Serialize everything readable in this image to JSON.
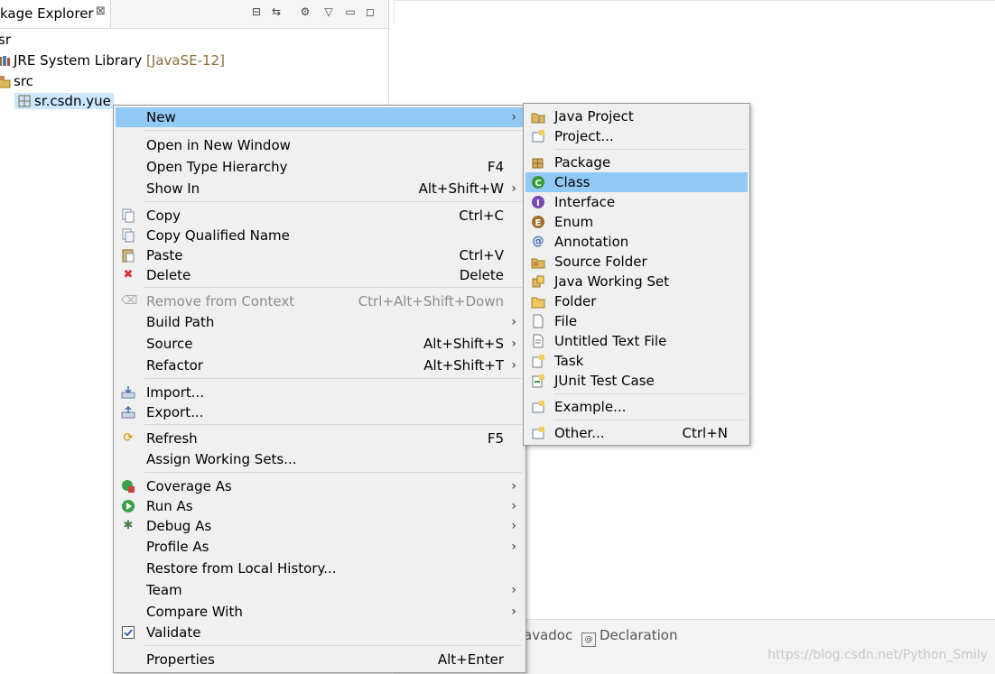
{
  "colors": {
    "highlight": "#91c9f7",
    "selection": "#cce8ff",
    "menu_bg": "#f0f0f0"
  },
  "package_explorer": {
    "tab_label": "kage Explorer",
    "close_glyph": "⊠",
    "tree": {
      "project": "sr",
      "jre_label": "JRE System Library",
      "jre_version": "[JavaSE-12]",
      "src": "src",
      "package": "sr.csdn.yue"
    }
  },
  "bottom": {
    "javadoc_tab": "avadoc",
    "declaration_tab": "Declaration",
    "watermark": "https://blog.csdn.net/Python_Smily"
  },
  "main_menu": [
    {
      "label": "New",
      "accel": "",
      "submenu": true,
      "icon": ""
    },
    {
      "label": "Open in New Window",
      "accel": "",
      "icon": ""
    },
    {
      "label": "Open Type Hierarchy",
      "accel": "F4",
      "icon": ""
    },
    {
      "label": "Show In",
      "accel": "Alt+Shift+W",
      "submenu": true,
      "icon": ""
    },
    {
      "label": "Copy",
      "accel": "Ctrl+C",
      "icon": "copy-icon"
    },
    {
      "label": "Copy Qualified Name",
      "accel": "",
      "icon": "copy-qualified-icon"
    },
    {
      "label": "Paste",
      "accel": "Ctrl+V",
      "icon": "paste-icon"
    },
    {
      "label": "Delete",
      "accel": "Delete",
      "icon": "delete-icon"
    },
    {
      "label": "Remove from Context",
      "accel": "Ctrl+Alt+Shift+Down",
      "disabled": true,
      "icon": "remove-context-icon"
    },
    {
      "label": "Build Path",
      "accel": "",
      "submenu": true,
      "icon": ""
    },
    {
      "label": "Source",
      "accel": "Alt+Shift+S",
      "submenu": true,
      "icon": ""
    },
    {
      "label": "Refactor",
      "accel": "Alt+Shift+T",
      "submenu": true,
      "icon": ""
    },
    {
      "label": "Import...",
      "accel": "",
      "icon": "import-icon"
    },
    {
      "label": "Export...",
      "accel": "",
      "icon": "export-icon"
    },
    {
      "label": "Refresh",
      "accel": "F5",
      "icon": "refresh-icon"
    },
    {
      "label": "Assign Working Sets...",
      "accel": "",
      "icon": ""
    },
    {
      "label": "Coverage As",
      "accel": "",
      "submenu": true,
      "icon": "coverage-icon"
    },
    {
      "label": "Run As",
      "accel": "",
      "submenu": true,
      "icon": "run-icon"
    },
    {
      "label": "Debug As",
      "accel": "",
      "submenu": true,
      "icon": "debug-icon"
    },
    {
      "label": "Profile As",
      "accel": "",
      "submenu": true,
      "icon": ""
    },
    {
      "label": "Restore from Local History...",
      "accel": "",
      "icon": ""
    },
    {
      "label": "Team",
      "accel": "",
      "submenu": true,
      "icon": ""
    },
    {
      "label": "Compare With",
      "accel": "",
      "submenu": true,
      "icon": ""
    },
    {
      "label": "Validate",
      "accel": "",
      "icon": "validate-check-icon"
    },
    {
      "label": "Properties",
      "accel": "Alt+Enter",
      "icon": ""
    }
  ],
  "sub_menu": [
    {
      "label": "Java Project",
      "accel": "",
      "icon": "java-project-icon"
    },
    {
      "label": "Project...",
      "accel": "",
      "icon": "project-icon"
    },
    {
      "label": "Package",
      "accel": "",
      "icon": "package-icon"
    },
    {
      "label": "Class",
      "accel": "",
      "icon": "class-icon",
      "highlighted": true
    },
    {
      "label": "Interface",
      "accel": "",
      "icon": "interface-icon"
    },
    {
      "label": "Enum",
      "accel": "",
      "icon": "enum-icon"
    },
    {
      "label": "Annotation",
      "accel": "",
      "icon": "annotation-icon"
    },
    {
      "label": "Source Folder",
      "accel": "",
      "icon": "source-folder-icon"
    },
    {
      "label": "Java Working Set",
      "accel": "",
      "icon": "working-set-icon"
    },
    {
      "label": "Folder",
      "accel": "",
      "icon": "folder-icon"
    },
    {
      "label": "File",
      "accel": "",
      "icon": "file-icon"
    },
    {
      "label": "Untitled Text File",
      "accel": "",
      "icon": "text-file-icon"
    },
    {
      "label": "Task",
      "accel": "",
      "icon": "task-icon"
    },
    {
      "label": "JUnit Test Case",
      "accel": "",
      "icon": "junit-icon"
    },
    {
      "label": "Example...",
      "accel": "",
      "icon": "example-icon"
    },
    {
      "label": "Other...",
      "accel": "Ctrl+N",
      "icon": "other-icon"
    }
  ]
}
